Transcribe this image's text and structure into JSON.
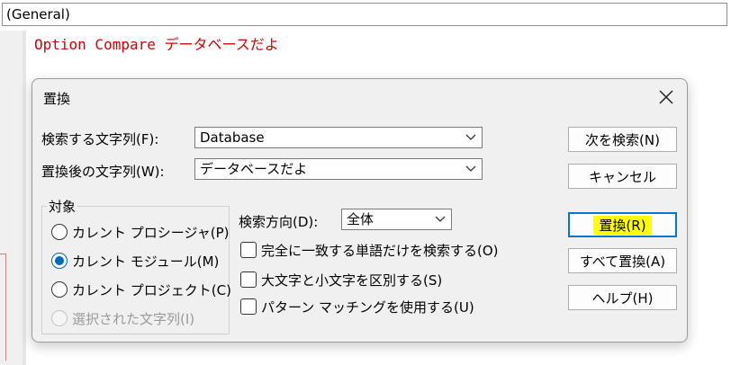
{
  "object_combo": {
    "value": "(General)"
  },
  "code": {
    "line1": "Option Compare データベースだよ"
  },
  "dialog": {
    "title": "置換",
    "find_label": "検索する文字列(F):",
    "find_value": "Database",
    "replace_label": "置換後の文字列(W):",
    "replace_value": "データベースだよ",
    "scope_group_title": "対象",
    "scope_options": [
      "カレント プロシージャ(P)",
      "カレント モジュール(M)",
      "カレント プロジェクト(C)",
      "選択された文字列(I)"
    ],
    "scope_selected": "カレント モジュール(M)",
    "direction_label": "検索方向(D):",
    "direction_value": "全体",
    "options": [
      "完全に一致する単語だけを検索する(O)",
      "大文字と小文字を区別する(S)",
      "パターン マッチングを使用する(U)"
    ],
    "buttons": {
      "find_next": "次を検索(N)",
      "cancel": "キャンセル",
      "replace": "置換(R)",
      "replace_all": "すべて置換(A)",
      "help": "ヘルプ(H)"
    },
    "highlight_color": "#ffff00",
    "accent_color": "#0078d4"
  }
}
